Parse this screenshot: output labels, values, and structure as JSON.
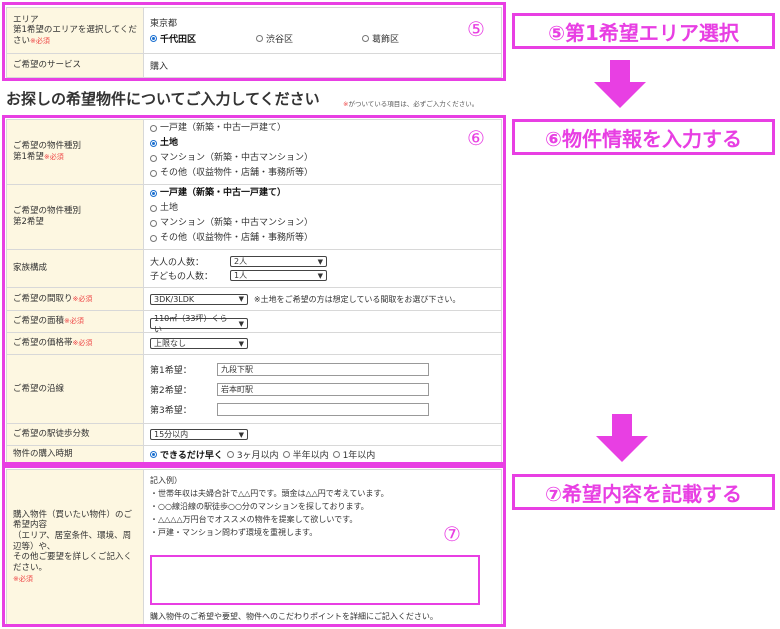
{
  "section1": {
    "area_label": "エリア\n第1希望のエリアを選択してください",
    "area_required": "※必須",
    "prefecture": "東京都",
    "area_options": [
      {
        "label": "千代田区",
        "checked": true
      },
      {
        "label": "渋谷区",
        "checked": false
      },
      {
        "label": "葛飾区",
        "checked": false
      }
    ],
    "service_label": "ご希望のサービス",
    "service_value": "購入",
    "badge": "⑤"
  },
  "heading": "お探しの希望物件についてご入力してください",
  "note_mark": "※",
  "note_text": "がついている項目は、必ずご入力ください。",
  "section2": {
    "badge": "⑥",
    "type1_label": "ご希望の物件種別\n第1希望",
    "type1_required": "※必須",
    "type1_options": [
      {
        "label": "一戸建（新築・中古一戸建て）",
        "checked": false
      },
      {
        "label": "土地",
        "checked": true
      },
      {
        "label": "マンション（新築・中古マンション）",
        "checked": false
      },
      {
        "label": "その他（収益物件・店舗・事務所等）",
        "checked": false
      }
    ],
    "type2_label": "ご希望の物件種別\n第2希望",
    "type2_options": [
      {
        "label": "一戸建（新築・中古一戸建て）",
        "checked": true
      },
      {
        "label": "土地",
        "checked": false
      },
      {
        "label": "マンション（新築・中古マンション）",
        "checked": false
      },
      {
        "label": "その他（収益物件・店舗・事務所等）",
        "checked": false
      }
    ],
    "family_label": "家族構成",
    "adults_label": "大人の人数：",
    "adults_value": "2人",
    "children_label": "子どもの人数：",
    "children_value": "1人",
    "layout_label": "ご希望の間取り",
    "layout_required": "※必須",
    "layout_value": "3DK/3LDK",
    "layout_note": "※土地をご希望の方は想定している間取をお選び下さい。",
    "size_label": "ご希望の面積",
    "size_required": "※必須",
    "size_value": "110㎡（33坪）くらい",
    "price_label": "ご希望の価格帯",
    "price_required": "※必須",
    "price_value": "上限なし",
    "line_label": "ご希望の沿線",
    "line1_label": "第1希望：",
    "line1_value": "九段下駅",
    "line2_label": "第2希望：",
    "line2_value": "岩本町駅",
    "line3_label": "第3希望：",
    "line3_value": "",
    "walk_label": "ご希望の駅徒歩分数",
    "walk_value": "15分以内",
    "timing_label": "物件の購入時期",
    "timing_options": [
      {
        "label": "できるだけ早く",
        "checked": true
      },
      {
        "label": "3ヶ月以内",
        "checked": false
      },
      {
        "label": "半年以内",
        "checked": false
      },
      {
        "label": "1年以内",
        "checked": false
      }
    ]
  },
  "section3": {
    "badge": "⑦",
    "label": "購入物件（買いたい物件）のご希望内容\n（エリア、居室条件、環境、周辺等）や、\nその他ご要望を詳しくご記入ください。",
    "required": "※必須",
    "example_title": "記入例）",
    "example_lines": [
      "・世帯年収は夫婦合計で△△円です。頭金は△△円で考えています。",
      "・○○線沿線の駅徒歩○○分のマンションを探しております。",
      "・△△△△万円台でオススメの物件を提案して欲しいです。",
      "・戸建・マンション問わず環境を重視します。"
    ],
    "textarea_value": "",
    "footnote": "購入物件のご希望や要望、物件へのこだわりポイントを詳細にご記入ください。"
  },
  "callouts": {
    "c5": "⑤第1希望エリア選択",
    "c6": "⑥物件情報を入力する",
    "c7": "⑦希望内容を記載する"
  },
  "colors": {
    "accent": "#e83fe3",
    "label_bg": "#fdf7e1",
    "required": "#e44444"
  }
}
